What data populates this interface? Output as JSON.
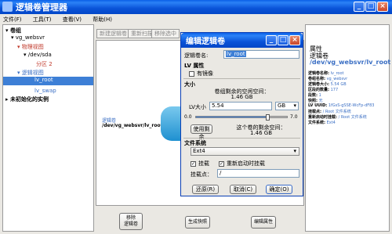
{
  "main_window": {
    "title": "逻辑卷管理器",
    "menu": [
      "文件(F)",
      "工具(T)",
      "查看(V)",
      "帮助(H)"
    ],
    "toolbar": [
      "新建逻辑卷",
      "重新扫描",
      "移除选中"
    ],
    "tree": {
      "root": "卷组",
      "vg": "vg_websvr",
      "physical": "物理视图",
      "partition": "/dev/sda",
      "partition_num": "分区 2",
      "logical": "逻辑视图",
      "lv_root": "lv_root",
      "lv_swap": "lv_swap",
      "uninit": "未初始化的实例"
    },
    "canvas": {
      "label1": "逻辑卷",
      "label2": "/dev/vg_websvr/lv_root"
    },
    "actions": [
      "移除\n逻辑卷",
      "生成快照",
      "编辑属性"
    ],
    "props": {
      "header": "属性",
      "subheader": "逻辑卷",
      "path": "/dev/vg_websvr/lv_root",
      "rows": [
        {
          "k": "逻辑卷名称:",
          "v": "lv_root"
        },
        {
          "k": "卷组名称:",
          "v": "vg_websvr"
        },
        {
          "k": "逻辑卷大小:",
          "v": "5.54 GB"
        },
        {
          "k": "区段的数量:",
          "v": "177"
        },
        {
          "k": "段数:",
          "v": "1"
        },
        {
          "k": "快照:",
          "v": "无"
        },
        {
          "k": "LV UUID:",
          "v": "1fGsS-gSSE-WcFp-dF83"
        },
        {
          "k": "挂载点:",
          "v": "/ Root 文件系统"
        },
        {
          "k": "重新启动时挂载:",
          "v": "/ Root 文件系统"
        },
        {
          "k": "文件系统:",
          "v": "Ext4"
        }
      ]
    }
  },
  "dialog": {
    "title": "编辑逻辑卷",
    "lv_name_label": "逻辑卷名:",
    "lv_name_value": "lv_root",
    "lv_props": "LV 属性",
    "mirror": "有镜像",
    "size": "大小",
    "remaining_label": "卷组剩余的空闲空间：",
    "remaining_value": "1.46 GB",
    "lv_size_label": "LV大小",
    "lv_size_value": "5.54",
    "unit": "GB",
    "min_label": "0.0",
    "max_label": "7.0",
    "slider_fraction": 0.79,
    "use_remaining": "使用剩余",
    "after_label": "这个卷的剩余空间：",
    "after_value": "1.46 GB",
    "filesystem": "文件系统",
    "fs_value": "Ext4",
    "mount": "挂载",
    "mount_reboot": "重新启动时挂载",
    "mountpoint_label": "挂载点：",
    "mountpoint_value": "/",
    "revert": "还原(R)",
    "cancel": "取消(C)",
    "ok": "确定(O)"
  }
}
